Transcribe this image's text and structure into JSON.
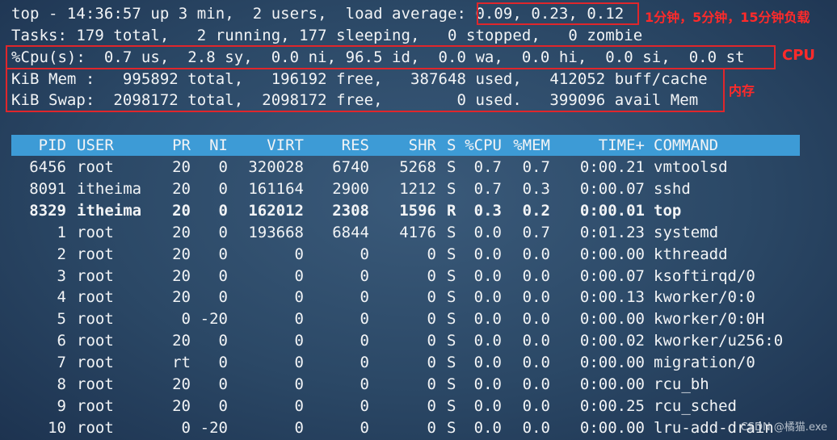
{
  "summary": {
    "line1": "top - 14:36:57 up 3 min,  2 users,  load average: 0.09, 0.23, 0.12",
    "line2": "Tasks: 179 total,   2 running, 177 sleeping,   0 stopped,   0 zombie",
    "line3": "%Cpu(s):  0.7 us,  2.8 sy,  0.0 ni, 96.5 id,  0.0 wa,  0.0 hi,  0.0 si,  0.0 st",
    "line4": "KiB Mem :   995892 total,   196192 free,   387648 used,   412052 buff/cache",
    "line5": "KiB Swap:  2098172 total,  2098172 free,        0 used.   399096 avail Mem"
  },
  "annotations": {
    "load": "1分钟，5分钟，15分钟负载",
    "cpu": "CPU",
    "mem": "内存"
  },
  "table": {
    "headers": [
      "PID",
      "USER",
      "PR",
      "NI",
      "VIRT",
      "RES",
      "SHR",
      "S",
      "%CPU",
      "%MEM",
      "TIME+",
      "COMMAND"
    ],
    "rows": [
      [
        "6456",
        "root",
        "20",
        "0",
        "320028",
        "6740",
        "5268",
        "S",
        "0.7",
        "0.7",
        "0:00.21",
        "vmtoolsd"
      ],
      [
        "8091",
        "itheima",
        "20",
        "0",
        "161164",
        "2900",
        "1212",
        "S",
        "0.7",
        "0.3",
        "0:00.07",
        "sshd"
      ],
      [
        "8329",
        "itheima",
        "20",
        "0",
        "162012",
        "2308",
        "1596",
        "R",
        "0.3",
        "0.2",
        "0:00.01",
        "top"
      ],
      [
        "1",
        "root",
        "20",
        "0",
        "193668",
        "6844",
        "4176",
        "S",
        "0.0",
        "0.7",
        "0:01.23",
        "systemd"
      ],
      [
        "2",
        "root",
        "20",
        "0",
        "0",
        "0",
        "0",
        "S",
        "0.0",
        "0.0",
        "0:00.00",
        "kthreadd"
      ],
      [
        "3",
        "root",
        "20",
        "0",
        "0",
        "0",
        "0",
        "S",
        "0.0",
        "0.0",
        "0:00.07",
        "ksoftirqd/0"
      ],
      [
        "4",
        "root",
        "20",
        "0",
        "0",
        "0",
        "0",
        "S",
        "0.0",
        "0.0",
        "0:00.13",
        "kworker/0:0"
      ],
      [
        "5",
        "root",
        "0",
        "-20",
        "0",
        "0",
        "0",
        "S",
        "0.0",
        "0.0",
        "0:00.00",
        "kworker/0:0H"
      ],
      [
        "6",
        "root",
        "20",
        "0",
        "0",
        "0",
        "0",
        "S",
        "0.0",
        "0.0",
        "0:00.02",
        "kworker/u256:0"
      ],
      [
        "7",
        "root",
        "rt",
        "0",
        "0",
        "0",
        "0",
        "S",
        "0.0",
        "0.0",
        "0:00.00",
        "migration/0"
      ],
      [
        "8",
        "root",
        "20",
        "0",
        "0",
        "0",
        "0",
        "S",
        "0.0",
        "0.0",
        "0:00.00",
        "rcu_bh"
      ],
      [
        "9",
        "root",
        "20",
        "0",
        "0",
        "0",
        "0",
        "S",
        "0.0",
        "0.0",
        "0:00.25",
        "rcu_sched"
      ],
      [
        "10",
        "root",
        "0",
        "-20",
        "0",
        "0",
        "0",
        "S",
        "0.0",
        "0.0",
        "0:00.00",
        "lru-add-drain"
      ]
    ],
    "bold_row": 2
  },
  "watermark": "CSDN @橘猫.exe",
  "colors": {
    "background": "#2c4966",
    "header_bar": "#3d9bd6",
    "annotation_red": "#e0262b",
    "text": "#f2f4f6"
  }
}
